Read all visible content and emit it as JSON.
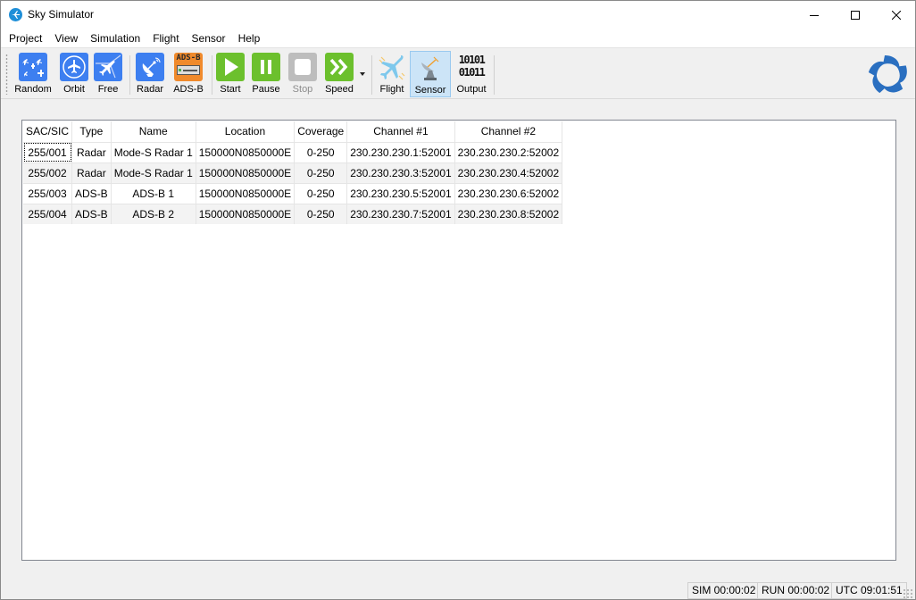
{
  "window": {
    "title": "Sky Simulator",
    "controls": {
      "minimize": "minimize-icon",
      "maximize": "maximize-icon",
      "close": "close-icon"
    }
  },
  "menu": {
    "items": [
      {
        "label": "Project"
      },
      {
        "label": "View"
      },
      {
        "label": "Simulation"
      },
      {
        "label": "Flight"
      },
      {
        "label": "Sensor"
      },
      {
        "label": "Help"
      }
    ]
  },
  "toolbar": {
    "buttons": [
      {
        "label": "Random",
        "icon": "random-flights-icon"
      },
      {
        "label": "Orbit",
        "icon": "orbit-flight-icon"
      },
      {
        "label": "Free",
        "icon": "free-flight-icon"
      },
      {
        "label": "Radar",
        "icon": "radar-dish-icon"
      },
      {
        "label": "ADS-B",
        "icon": "adsb-receiver-icon",
        "icon_text": "ADS-B"
      },
      {
        "label": "Start",
        "icon": "play-icon"
      },
      {
        "label": "Pause",
        "icon": "pause-icon"
      },
      {
        "label": "Stop",
        "icon": "stop-icon",
        "disabled": true
      },
      {
        "label": "Speed",
        "icon": "fast-forward-icon"
      },
      {
        "label": "Flight",
        "icon": "airplane-icon"
      },
      {
        "label": "Sensor",
        "icon": "satellite-dish-icon",
        "active": true
      },
      {
        "label": "Output",
        "icon": "binary-output-icon",
        "icon_text": [
          "10101",
          "01011"
        ]
      }
    ]
  },
  "table": {
    "columns": [
      "SAC/SIC",
      "Type",
      "Name",
      "Location",
      "Coverage",
      "Channel #1",
      "Channel #2"
    ],
    "rows": [
      [
        "255/001",
        "Radar",
        "Mode-S Radar 1",
        "150000N0850000E",
        "0-250",
        "230.230.230.1:52001",
        "230.230.230.2:52002"
      ],
      [
        "255/002",
        "Radar",
        "Mode-S Radar 1",
        "150000N0850000E",
        "0-250",
        "230.230.230.3:52001",
        "230.230.230.4:52002"
      ],
      [
        "255/003",
        "ADS-B",
        "ADS-B 1",
        "150000N0850000E",
        "0-250",
        "230.230.230.5:52001",
        "230.230.230.6:52002"
      ],
      [
        "255/004",
        "ADS-B",
        "ADS-B 2",
        "150000N0850000E",
        "0-250",
        "230.230.230.7:52001",
        "230.230.230.8:52002"
      ]
    ]
  },
  "status": {
    "sim": "SIM 00:00:02",
    "run": "RUN 00:00:02",
    "utc": "UTC 09:01:51"
  },
  "colors": {
    "blue_icon": "#3d7ff0",
    "green_icon": "#6cc02d",
    "orange_icon": "#f08a2c",
    "active_button": "#cce4f7"
  }
}
